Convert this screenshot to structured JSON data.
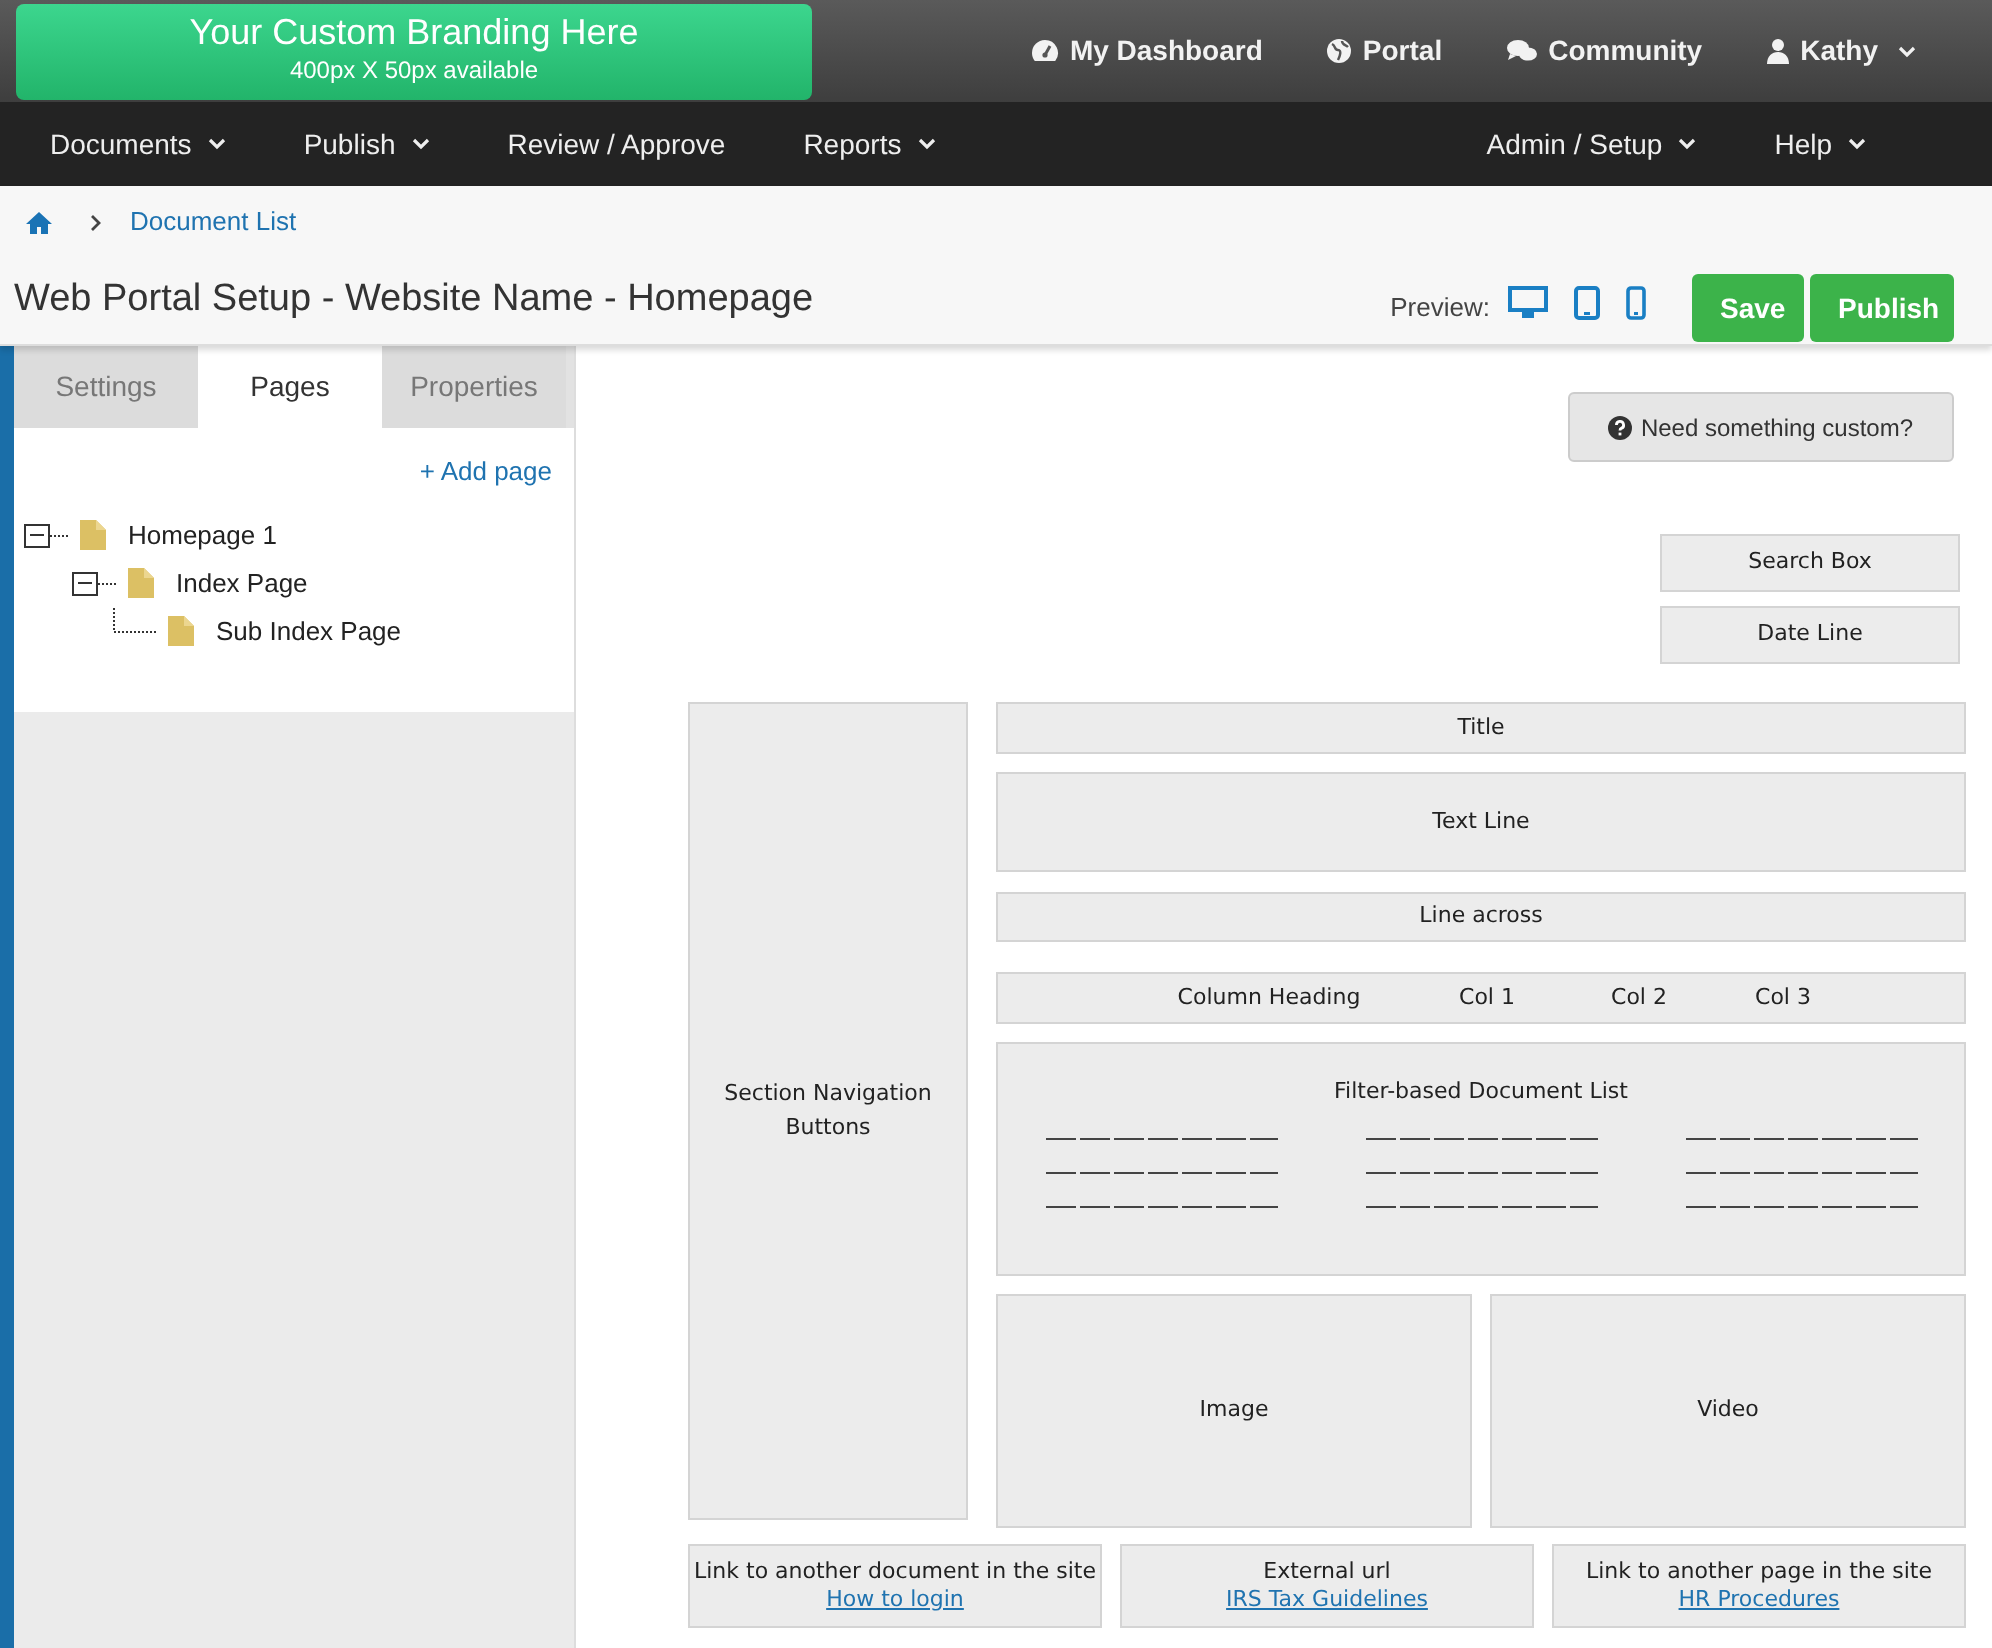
{
  "branding": {
    "title": "Your Custom Branding Here",
    "subtitle": "400px X 50px available"
  },
  "top_links": [
    {
      "kind": "dashboard",
      "label": "My Dashboard",
      "dropdown": false
    },
    {
      "kind": "globe",
      "label": "Portal",
      "dropdown": false
    },
    {
      "kind": "chat",
      "label": "Community",
      "dropdown": false
    },
    {
      "kind": "user",
      "label": "Kathy",
      "dropdown": true
    }
  ],
  "nav_left": [
    {
      "label": "Documents",
      "dropdown": true
    },
    {
      "label": "Publish",
      "dropdown": true
    },
    {
      "label": "Review / Approve",
      "dropdown": false
    },
    {
      "label": "Reports",
      "dropdown": true
    }
  ],
  "nav_right": [
    {
      "label": "Admin / Setup",
      "dropdown": true
    },
    {
      "label": "Help",
      "dropdown": true
    }
  ],
  "breadcrumb": {
    "current": "Document List"
  },
  "page_title": "Web Portal Setup - Website Name - Homepage",
  "preview": {
    "label": "Preview:",
    "devices": [
      {
        "kind": "desktop"
      },
      {
        "kind": "tablet"
      },
      {
        "kind": "phone"
      }
    ]
  },
  "buttons": [
    {
      "label": "Save"
    },
    {
      "label": "Publish"
    }
  ],
  "sidebar": {
    "tabs": [
      {
        "label": "Settings",
        "selected": false
      },
      {
        "label": "Pages",
        "selected": true
      },
      {
        "label": "Properties",
        "selected": false
      }
    ],
    "add_page": "+ Add page",
    "tree": [
      {
        "label": "Homepage 1",
        "expanded": true,
        "children": [
          {
            "label": "Index Page",
            "expanded": true,
            "children": [
              {
                "label": "Sub Index Page"
              }
            ]
          }
        ]
      }
    ]
  },
  "canvas": {
    "custom_button": "Need something custom?",
    "top_right_blocks": [
      "Search Box",
      "Date Line"
    ],
    "side_block": "Section Navigation Buttons",
    "rows": [
      "Title",
      "Text Line",
      "Line across"
    ],
    "column_heading": [
      "Column Heading",
      "Col 1",
      "Col 2",
      "Col 3"
    ],
    "document_list": {
      "title": "Filter-based Document List"
    },
    "media": [
      "Image",
      "Video"
    ],
    "links": [
      {
        "caption": "Link to another document in the site",
        "link": "How to login"
      },
      {
        "caption": "External url",
        "link": "IRS Tax Guidelines"
      },
      {
        "caption": "Link to another page in the site",
        "link": "HR Procedures"
      }
    ]
  }
}
